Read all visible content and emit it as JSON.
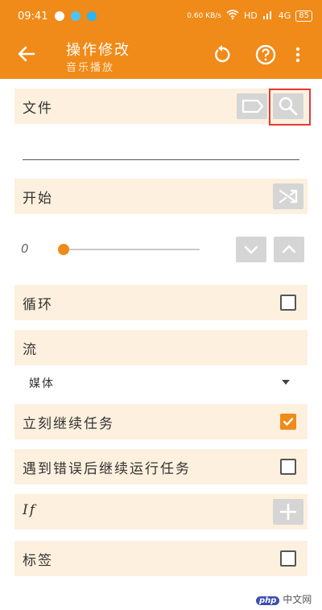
{
  "status_bar": {
    "time": "09:41",
    "network": "0.60 KB/s",
    "hd": "HD",
    "signal": "4G",
    "battery": "85"
  },
  "toolbar": {
    "title": "操作修改",
    "subtitle": "音乐播放",
    "back_icon": "arrow-left-icon",
    "reset_icon": "reset-icon",
    "help_icon": "help-circle-icon",
    "menu_icon": "more-vertical-icon"
  },
  "file_row": {
    "label": "文件",
    "tag_icon": "label-icon",
    "search_icon": "search-icon"
  },
  "start_row": {
    "label": "开始",
    "shuffle_icon": "shuffle-icon"
  },
  "slider": {
    "value": "0",
    "position_fraction": 0
  },
  "loop_row": {
    "label": "循环",
    "checked": false
  },
  "stream_row": {
    "label": "流",
    "selected": "媒体"
  },
  "continue_row": {
    "label": "立刻继续任务",
    "checked": true
  },
  "error_row": {
    "label": "遇到错误后继续运行任务",
    "checked": false
  },
  "if_row": {
    "label": "If",
    "add_icon": "plus-icon"
  },
  "tag_row": {
    "label": "标签",
    "checked": false
  },
  "watermark": {
    "badge": "php",
    "text": "中文网"
  },
  "colors": {
    "accent": "#f08a18",
    "row_bg": "#fdf0de",
    "highlight": "#e53935"
  }
}
